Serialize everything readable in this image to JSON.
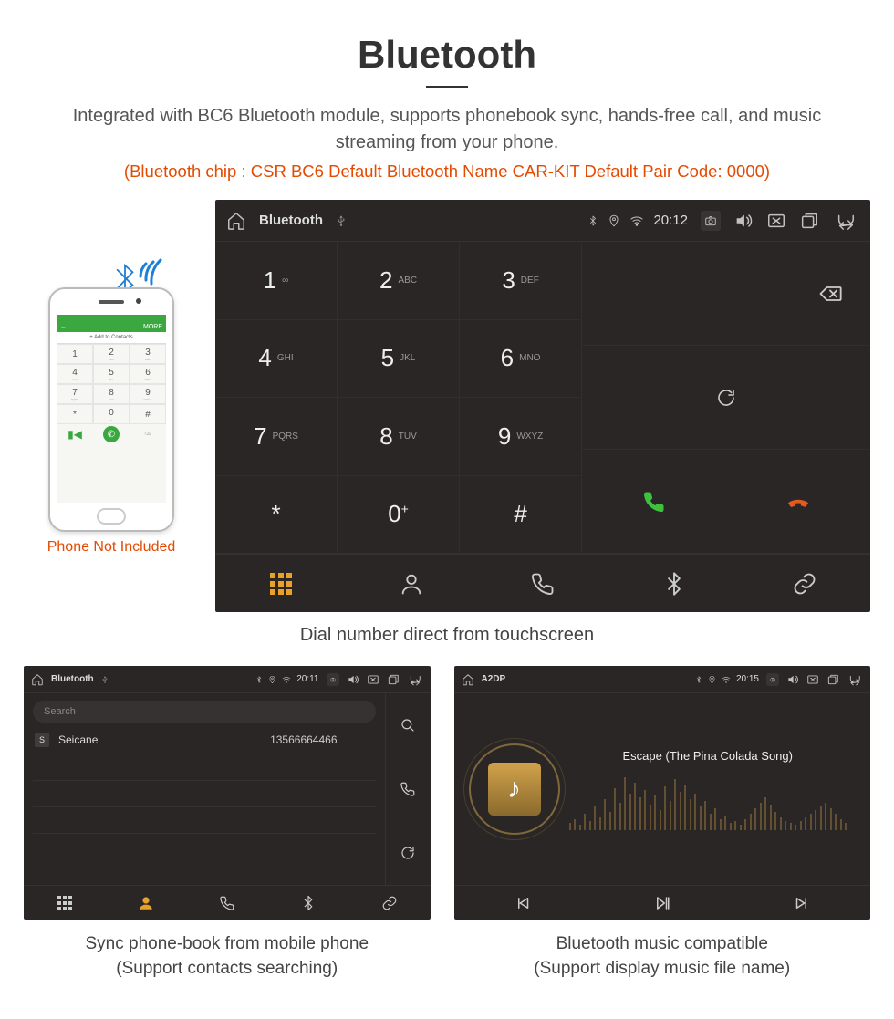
{
  "header": {
    "title": "Bluetooth",
    "desc": "Integrated with BC6 Bluetooth module, supports phonebook sync, hands-free call, and music streaming from your phone.",
    "spec": "(Bluetooth chip : CSR BC6     Default Bluetooth Name CAR-KIT     Default Pair Code: 0000)"
  },
  "phone": {
    "not_included": "Phone Not Included",
    "bar_left": "←",
    "bar_right": "MORE",
    "add_contacts": "+  Add to Contacts",
    "keys": [
      {
        "n": "1",
        "l": ""
      },
      {
        "n": "2",
        "l": "ABC"
      },
      {
        "n": "3",
        "l": "DEF"
      },
      {
        "n": "4",
        "l": "GHI"
      },
      {
        "n": "5",
        "l": "JKL"
      },
      {
        "n": "6",
        "l": "MNO"
      },
      {
        "n": "7",
        "l": "PQRS"
      },
      {
        "n": "8",
        "l": "TUV"
      },
      {
        "n": "9",
        "l": "WXYZ"
      },
      {
        "n": "*",
        "l": ""
      },
      {
        "n": "0",
        "l": "+"
      },
      {
        "n": "#",
        "l": ""
      }
    ]
  },
  "dialer": {
    "topbar": {
      "title": "Bluetooth",
      "time": "20:12"
    },
    "keys": [
      {
        "n": "1",
        "l": "∞"
      },
      {
        "n": "2",
        "l": "ABC"
      },
      {
        "n": "3",
        "l": "DEF"
      },
      {
        "n": "4",
        "l": "GHI"
      },
      {
        "n": "5",
        "l": "JKL"
      },
      {
        "n": "6",
        "l": "MNO"
      },
      {
        "n": "7",
        "l": "PQRS"
      },
      {
        "n": "8",
        "l": "TUV"
      },
      {
        "n": "9",
        "l": "WXYZ"
      },
      {
        "n": "*",
        "l": ""
      },
      {
        "n": "0",
        "l": "+",
        "sup": "true"
      },
      {
        "n": "#",
        "l": ""
      }
    ],
    "caption": "Dial number direct from touchscreen"
  },
  "phonebook": {
    "topbar": {
      "title": "Bluetooth",
      "time": "20:11"
    },
    "search_placeholder": "Search",
    "contact": {
      "badge": "S",
      "name": "Seicane",
      "number": "13566664466"
    },
    "caption_l1": "Sync phone-book from mobile phone",
    "caption_l2": "(Support contacts searching)"
  },
  "music": {
    "topbar": {
      "title": "A2DP",
      "time": "20:15"
    },
    "track": "Escape (The Pina Colada Song)",
    "caption_l1": "Bluetooth music compatible",
    "caption_l2": "(Support display music file name)"
  }
}
